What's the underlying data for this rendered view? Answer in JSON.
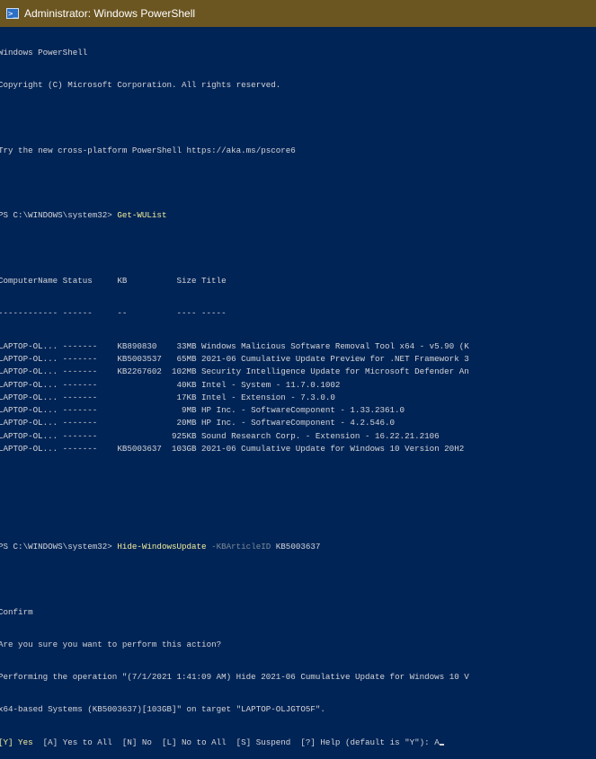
{
  "window": {
    "title": "Administrator: Windows PowerShell",
    "icon": "powershell-icon"
  },
  "banner": [
    "Windows PowerShell",
    "Copyright (C) Microsoft Corporation. All rights reserved.",
    "Try the new cross-platform PowerShell https://aka.ms/pscore6"
  ],
  "prompt1": {
    "prompt": "PS C:\\WINDOWS\\system32> ",
    "command": "Get-WUList"
  },
  "table": {
    "headers": {
      "name": "ComputerName",
      "status": "Status",
      "kb": "KB",
      "size": "Size",
      "title": "Title"
    },
    "separators": {
      "name": "------------",
      "status": "------",
      "kb": "--",
      "size": "----",
      "title": "-----"
    },
    "rows": [
      {
        "name": "LAPTOP-OL...",
        "status": "-------",
        "kb": "KB890830",
        "size": "33MB",
        "title": "Windows Malicious Software Removal Tool x64 - v5.90 (K"
      },
      {
        "name": "LAPTOP-OL...",
        "status": "-------",
        "kb": "KB5003537",
        "size": "65MB",
        "title": "2021-06 Cumulative Update Preview for .NET Framework 3"
      },
      {
        "name": "LAPTOP-OL...",
        "status": "-------",
        "kb": "KB2267602",
        "size": "102MB",
        "title": "Security Intelligence Update for Microsoft Defender An"
      },
      {
        "name": "LAPTOP-OL...",
        "status": "-------",
        "kb": "",
        "size": "40KB",
        "title": "Intel - System - 11.7.0.1002"
      },
      {
        "name": "LAPTOP-OL...",
        "status": "-------",
        "kb": "",
        "size": "17KB",
        "title": "Intel - Extension - 7.3.0.0"
      },
      {
        "name": "LAPTOP-OL...",
        "status": "-------",
        "kb": "",
        "size": "9MB",
        "title": "HP Inc. - SoftwareComponent - 1.33.2361.0"
      },
      {
        "name": "LAPTOP-OL...",
        "status": "-------",
        "kb": "",
        "size": "20MB",
        "title": "HP Inc. - SoftwareComponent - 4.2.546.0"
      },
      {
        "name": "LAPTOP-OL...",
        "status": "-------",
        "kb": "",
        "size": "925KB",
        "title": "Sound Research Corp. - Extension - 16.22.21.2106"
      },
      {
        "name": "LAPTOP-OL...",
        "status": "-------",
        "kb": "KB5003637",
        "size": "103GB",
        "title": "2021-06 Cumulative Update for Windows 10 Version 20H2"
      }
    ]
  },
  "prompt2": {
    "prompt": "PS C:\\WINDOWS\\system32> ",
    "command": "Hide-WindowsUpdate",
    "param": " -KBArticleID",
    "arg": " KB5003637"
  },
  "confirm": {
    "heading": "Confirm",
    "question": "Are you sure you want to perform this action?",
    "operation1": "Performing the operation \"(7/1/2021 1:41:09 AM) Hide 2021-06 Cumulative Update for Windows 10 V",
    "operation2": "x64-based Systems (KB5003637)[103GB]\" on target \"LAPTOP-OLJGTO5F\".",
    "choice_default": "[Y] Yes",
    "choices_rest": "  [A] Yes to All  [N] No  [L] No to All  [S] Suspend  [?] Help (default is \"Y\"): ",
    "input": "A"
  }
}
